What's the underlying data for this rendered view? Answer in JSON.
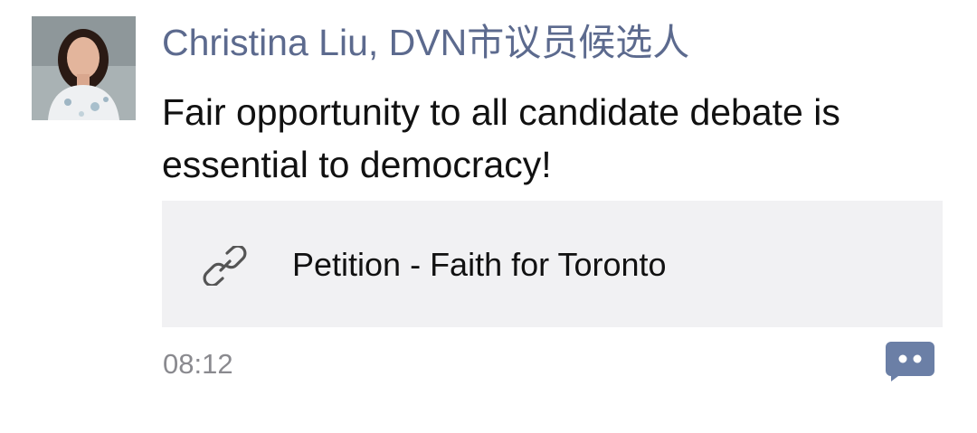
{
  "post": {
    "author": "Christina Liu, DVN市议员候选人",
    "text": "Fair opportunity to all candidate debate is essential to democracy!",
    "link": {
      "title": "Petition - Faith for Toronto"
    },
    "timestamp": "08:12"
  },
  "icons": {
    "link": "link-icon",
    "comment": "comment-bubble-icon",
    "avatar": "profile-photo"
  },
  "colors": {
    "author_name": "#5c6a8e",
    "link_card_bg": "#f1f1f3",
    "timestamp": "#8a8a8f",
    "comment_icon": "#6b7fa6"
  }
}
